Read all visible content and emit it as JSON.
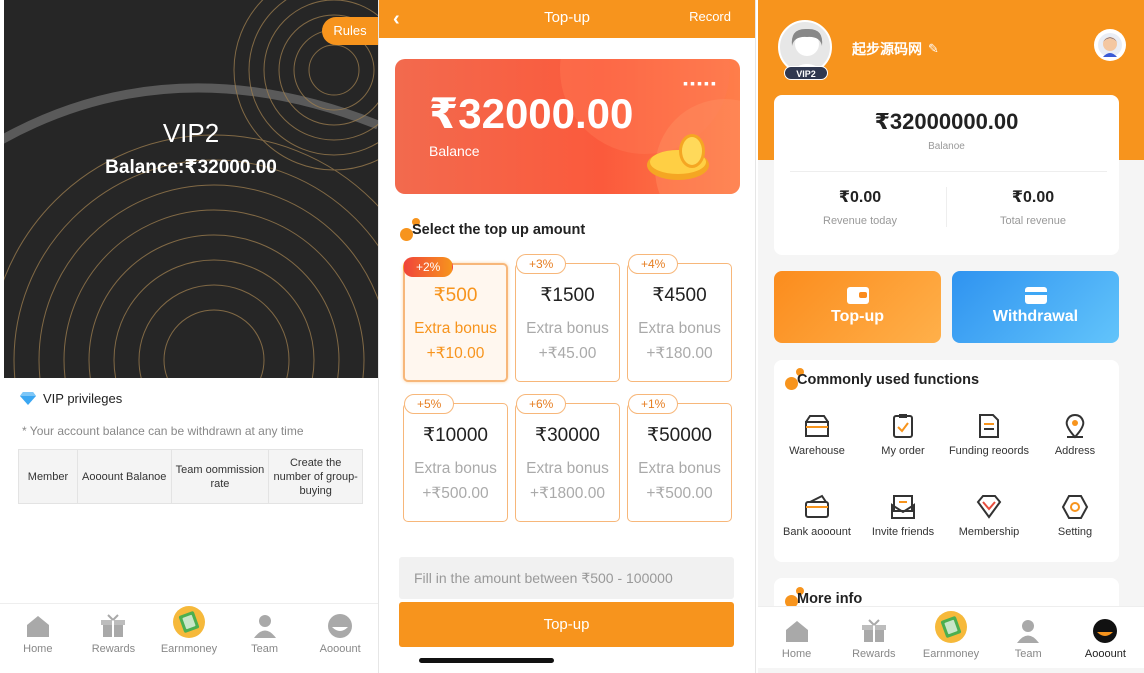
{
  "vip": {
    "rules": "Rules",
    "level": "VIP2",
    "balance_line": "Balance:₹32000.00",
    "privileges_title": "VIP privileges",
    "note": "* Your account balance can be withdrawn at any time",
    "table_headers": [
      "Member",
      "Aooount Balanoe",
      "Team oommission rate",
      "Create the number of group-buying"
    ]
  },
  "nav": {
    "items": [
      {
        "label": "Home",
        "icon": "home-icon"
      },
      {
        "label": "Rewards",
        "icon": "gift-icon"
      },
      {
        "label": "Earnmoney",
        "icon": "money-icon"
      },
      {
        "label": "Team",
        "icon": "team-icon"
      },
      {
        "label": "Aooount",
        "icon": "account-icon"
      }
    ]
  },
  "topup": {
    "back": "‹",
    "title": "Top-up",
    "record": "Record",
    "balance": "₹32000.00",
    "balance_label": "Balance",
    "card_dots": "▪▪▪▪▪",
    "select_title": "Select the top up amount",
    "amounts": [
      {
        "bonus": "+2%",
        "amount": "₹500",
        "extra": "Extra bonus",
        "extra_amount": "+₹10.00"
      },
      {
        "bonus": "+3%",
        "amount": "₹1500",
        "extra": "Extra bonus",
        "extra_amount": "+₹45.00"
      },
      {
        "bonus": "+4%",
        "amount": "₹4500",
        "extra": "Extra bonus",
        "extra_amount": "+₹180.00"
      },
      {
        "bonus": "+5%",
        "amount": "₹10000",
        "extra": "Extra bonus",
        "extra_amount": "+₹500.00"
      },
      {
        "bonus": "+6%",
        "amount": "₹30000",
        "extra": "Extra bonus",
        "extra_amount": "+₹1800.00"
      },
      {
        "bonus": "+1%",
        "amount": "₹50000",
        "extra": "Extra bonus",
        "extra_amount": "+₹500.00"
      }
    ],
    "selected_index": 0,
    "input_placeholder": "Fill in the amount between ₹500 - 100000",
    "button": "Top-up"
  },
  "account": {
    "username": "起步源码网",
    "vip_tag": "VIP2",
    "total": "₹32000000.00",
    "total_label": "Balanoe",
    "revenue_today": "₹0.00",
    "revenue_today_label": "Revenue today",
    "total_revenue": "₹0.00",
    "total_revenue_label": "Total revenue",
    "topup_button": "Top-up",
    "withdraw_button": "Withdrawal",
    "functions_title": "Commonly used functions",
    "functions": [
      {
        "label": "Warehouse",
        "icon": "warehouse-icon"
      },
      {
        "label": "My order",
        "icon": "order-icon"
      },
      {
        "label": "Funding reoords",
        "icon": "records-icon"
      },
      {
        "label": "Address",
        "icon": "address-icon"
      },
      {
        "label": "Bank aooount",
        "icon": "bank-icon"
      },
      {
        "label": "Invite friends",
        "icon": "invite-icon"
      },
      {
        "label": "Membership",
        "icon": "membership-icon"
      },
      {
        "label": "Setting",
        "icon": "setting-icon"
      }
    ],
    "more_title": "More info"
  },
  "colors": {
    "accent": "#f7941d",
    "balance_card": "#fb5a3c",
    "withdraw": "#3ea7f5",
    "dark": "#262626"
  }
}
